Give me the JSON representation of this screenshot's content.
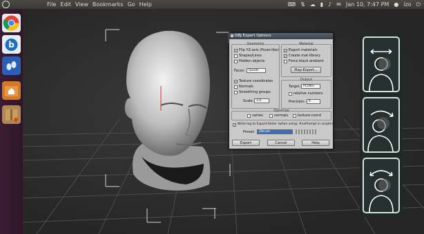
{
  "topbar": {
    "menu": [
      "File",
      "Edit",
      "View",
      "Bookmarks",
      "Go",
      "Help"
    ],
    "datetime": "Jan 10, 7:47 PM",
    "user": "izo"
  },
  "launcher": {
    "icons": [
      "chrome-icon",
      "bookmark-b-icon",
      "footprint-icon",
      "home-folder-icon",
      "package-icon"
    ]
  },
  "dialog": {
    "title": "OBJ Export Options",
    "geometry": {
      "label": "Geometry",
      "flip": "Flip YZ-axis (Poser-like)",
      "shapes": "Shapes/Lines",
      "hidden": "Hidden objects",
      "faces_label": "Faces:",
      "faces_value": "Quads",
      "texcoords": "Texture coordinates",
      "normals": "Normals",
      "smoothing": "Smoothing groups",
      "scale_label": "Scale:",
      "scale_value": "1.0"
    },
    "material": {
      "label": "Material",
      "export": "Export materials",
      "create": "Create mat-library",
      "force": "Force black ambient",
      "map_export": "Map-Export..."
    },
    "output": {
      "label": "Output",
      "target_label": "Target:",
      "target_value": "PC/Win",
      "relative": "relative numbers",
      "precision_label": "Precision:",
      "precision_value": "6"
    },
    "optimize": {
      "label": "Optimize",
      "vertex": "vertex",
      "normals": "normals",
      "texcoord": "texture-coord"
    },
    "log": "Write log to Export-folder (when using: #noPrompt in scripts)",
    "preset_label": "Preset:",
    "preset_value": "ZBrush",
    "buttons": {
      "export": "Export",
      "cancel": "Cancel",
      "help": "Help"
    }
  },
  "tools": [
    "move-head-icon",
    "rotate-head-icon",
    "spin-head-icon"
  ],
  "colors": {
    "launcher": "#2e1728",
    "topbar": "#3c3b37",
    "dialog": "#c9c9c9",
    "tool_border": "#d8e3dc"
  }
}
